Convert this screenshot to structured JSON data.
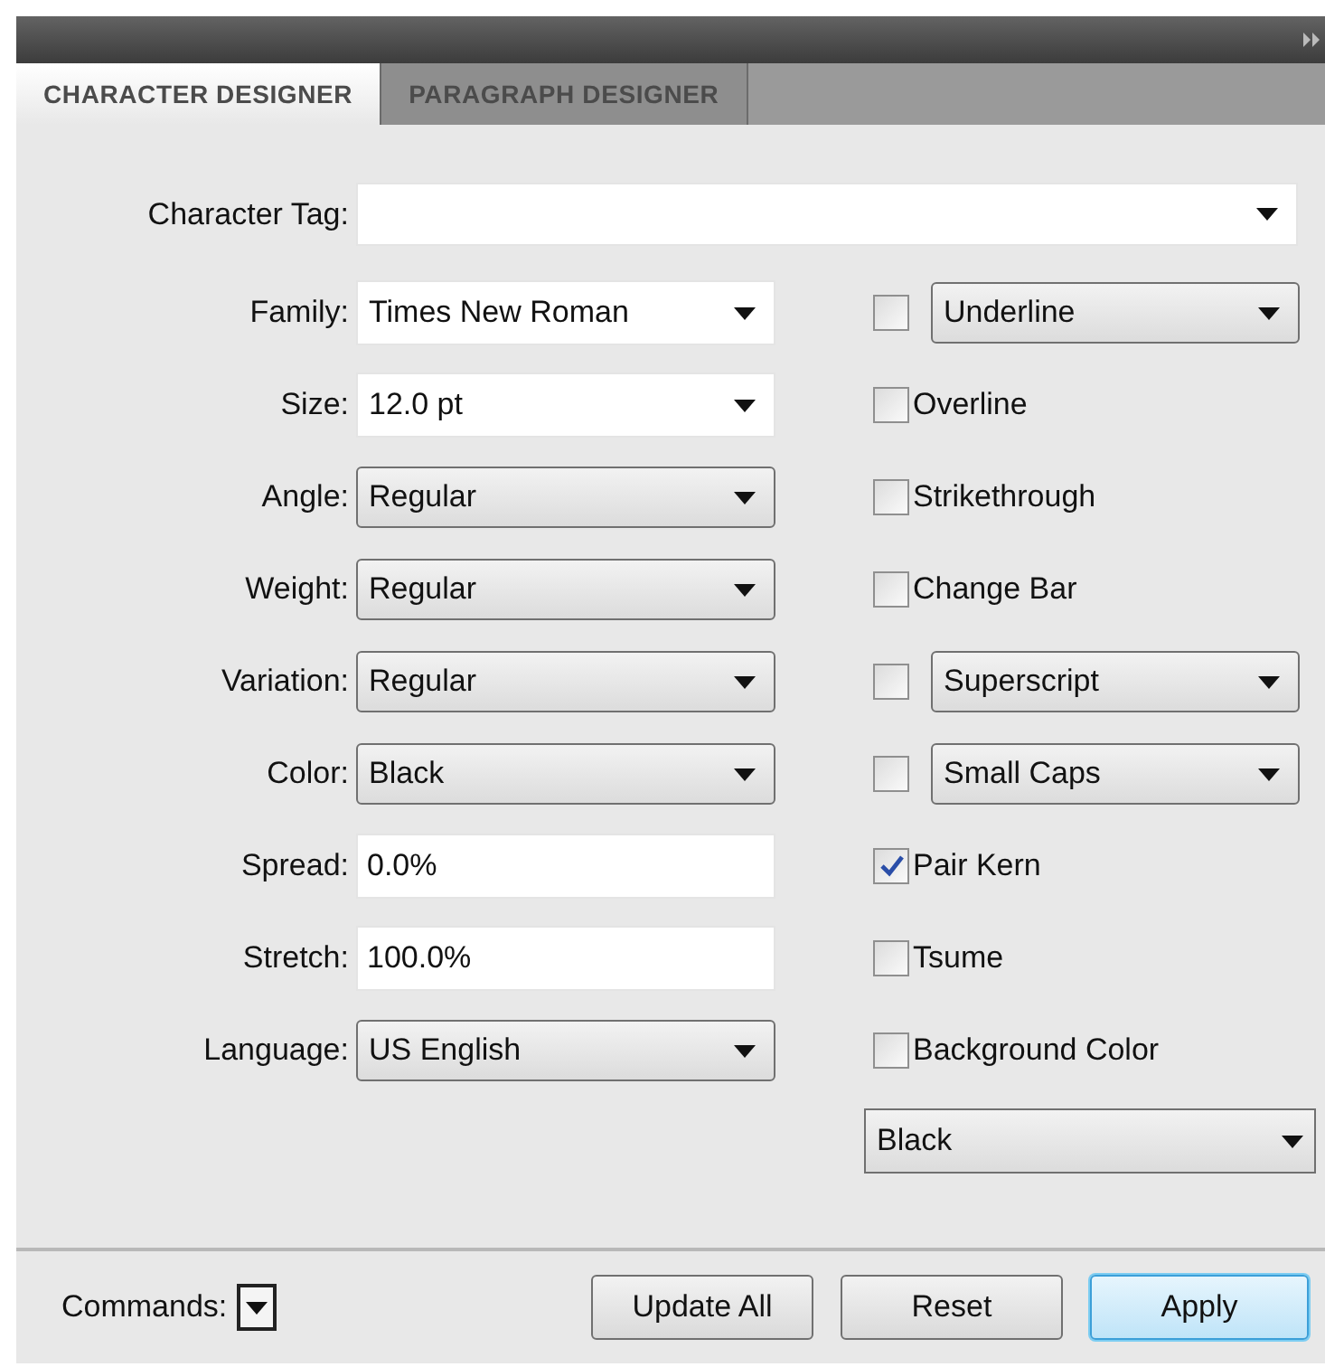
{
  "tabs": [
    {
      "label": "CHARACTER DESIGNER",
      "selected": true
    },
    {
      "label": "PARAGRAPH DESIGNER",
      "selected": false
    }
  ],
  "character_tag": {
    "label": "Character Tag:"
  },
  "left": [
    {
      "label": "Family:",
      "kind": "combo",
      "value": "Times New Roman"
    },
    {
      "label": "Size:",
      "kind": "combo",
      "value": "12.0 pt"
    },
    {
      "label": "Angle:",
      "kind": "select",
      "value": "Regular"
    },
    {
      "label": "Weight:",
      "kind": "select",
      "value": "Regular"
    },
    {
      "label": "Variation:",
      "kind": "select",
      "value": "Regular"
    },
    {
      "label": "Color:",
      "kind": "select",
      "value": "Black"
    },
    {
      "label": "Spread:",
      "kind": "text",
      "value": "0.0%"
    },
    {
      "label": "Stretch:",
      "kind": "text",
      "value": "100.0%"
    },
    {
      "label": "Language:",
      "kind": "select",
      "value": "US English"
    }
  ],
  "right": [
    {
      "kind": "check_select",
      "label": "Underline",
      "checked": false
    },
    {
      "kind": "check",
      "label": "Overline",
      "checked": false
    },
    {
      "kind": "check",
      "label": "Strikethrough",
      "checked": false
    },
    {
      "kind": "check",
      "label": "Change Bar",
      "checked": false
    },
    {
      "kind": "check_select",
      "label": "Superscript",
      "checked": false
    },
    {
      "kind": "check_select",
      "label": "Small Caps",
      "checked": false
    },
    {
      "kind": "check",
      "label": "Pair Kern",
      "checked": true
    },
    {
      "kind": "check",
      "label": "Tsume",
      "checked": false
    },
    {
      "kind": "check",
      "label": "Background Color",
      "checked": false
    }
  ],
  "background_color": {
    "value": "Black"
  },
  "commands": {
    "label": "Commands:"
  },
  "buttons": [
    {
      "label": "Update All",
      "default": false
    },
    {
      "label": "Reset",
      "default": false
    },
    {
      "label": "Apply",
      "default": true
    }
  ]
}
